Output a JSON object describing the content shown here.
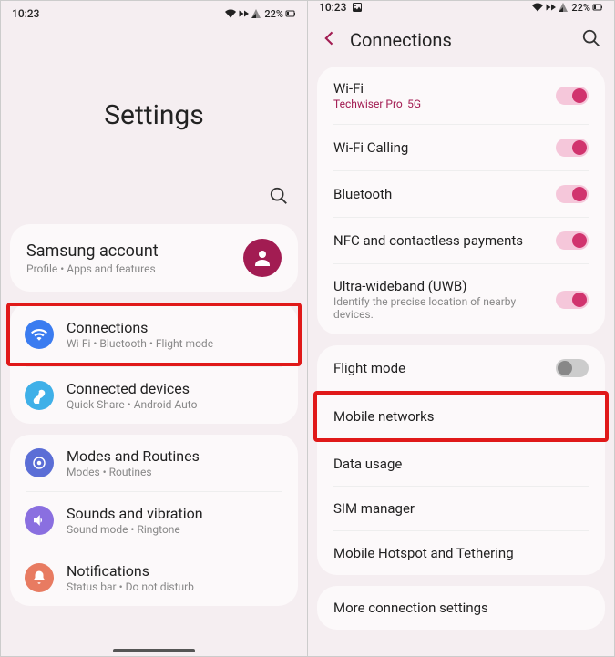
{
  "status": {
    "time": "10:23",
    "battery": "22%"
  },
  "left": {
    "title": "Settings",
    "account": {
      "title": "Samsung account",
      "sub": "Profile  •  Apps and features"
    },
    "groups": [
      [
        {
          "name": "connections",
          "label": "Connections",
          "sub": "Wi-Fi  •  Bluetooth  •  Flight mode",
          "icon_bg": "#3b7cf0",
          "highlight": true
        },
        {
          "name": "connected-devices",
          "label": "Connected devices",
          "sub": "Quick Share  •  Android Auto",
          "icon_bg": "#3fb0e8"
        }
      ],
      [
        {
          "name": "modes-routines",
          "label": "Modes and Routines",
          "sub": "Modes  •  Routines",
          "icon_bg": "#5b6ed6"
        },
        {
          "name": "sounds-vibration",
          "label": "Sounds and vibration",
          "sub": "Sound mode  •  Ringtone",
          "icon_bg": "#8a6fe0"
        },
        {
          "name": "notifications",
          "label": "Notifications",
          "sub": "Status bar  •  Do not disturb",
          "icon_bg": "#e87b61"
        }
      ]
    ]
  },
  "right": {
    "title": "Connections",
    "groups": [
      [
        {
          "name": "wifi",
          "label": "Wi-Fi",
          "sub": "Techwiser Pro_5G",
          "sub_color": "accent",
          "toggle": "on"
        },
        {
          "name": "wifi-calling",
          "label": "Wi-Fi Calling",
          "toggle": "on"
        },
        {
          "name": "bluetooth",
          "label": "Bluetooth",
          "toggle": "on"
        },
        {
          "name": "nfc",
          "label": "NFC and contactless payments",
          "toggle": "on"
        },
        {
          "name": "uwb",
          "label": "Ultra-wideband (UWB)",
          "sub": "Identify the precise location of nearby devices.",
          "sub_color": "gray",
          "toggle": "on"
        }
      ],
      [
        {
          "name": "flight-mode",
          "label": "Flight mode",
          "toggle": "off"
        },
        {
          "name": "mobile-networks",
          "label": "Mobile networks",
          "highlight": true
        },
        {
          "name": "data-usage",
          "label": "Data usage"
        },
        {
          "name": "sim-manager",
          "label": "SIM manager"
        },
        {
          "name": "hotspot",
          "label": "Mobile Hotspot and Tethering"
        }
      ],
      [
        {
          "name": "more-connection",
          "label": "More connection settings"
        }
      ]
    ]
  },
  "icons": {
    "connections": "wifi",
    "connected-devices": "link",
    "modes-routines": "circle-dot",
    "sounds-vibration": "speaker",
    "notifications": "bell"
  }
}
